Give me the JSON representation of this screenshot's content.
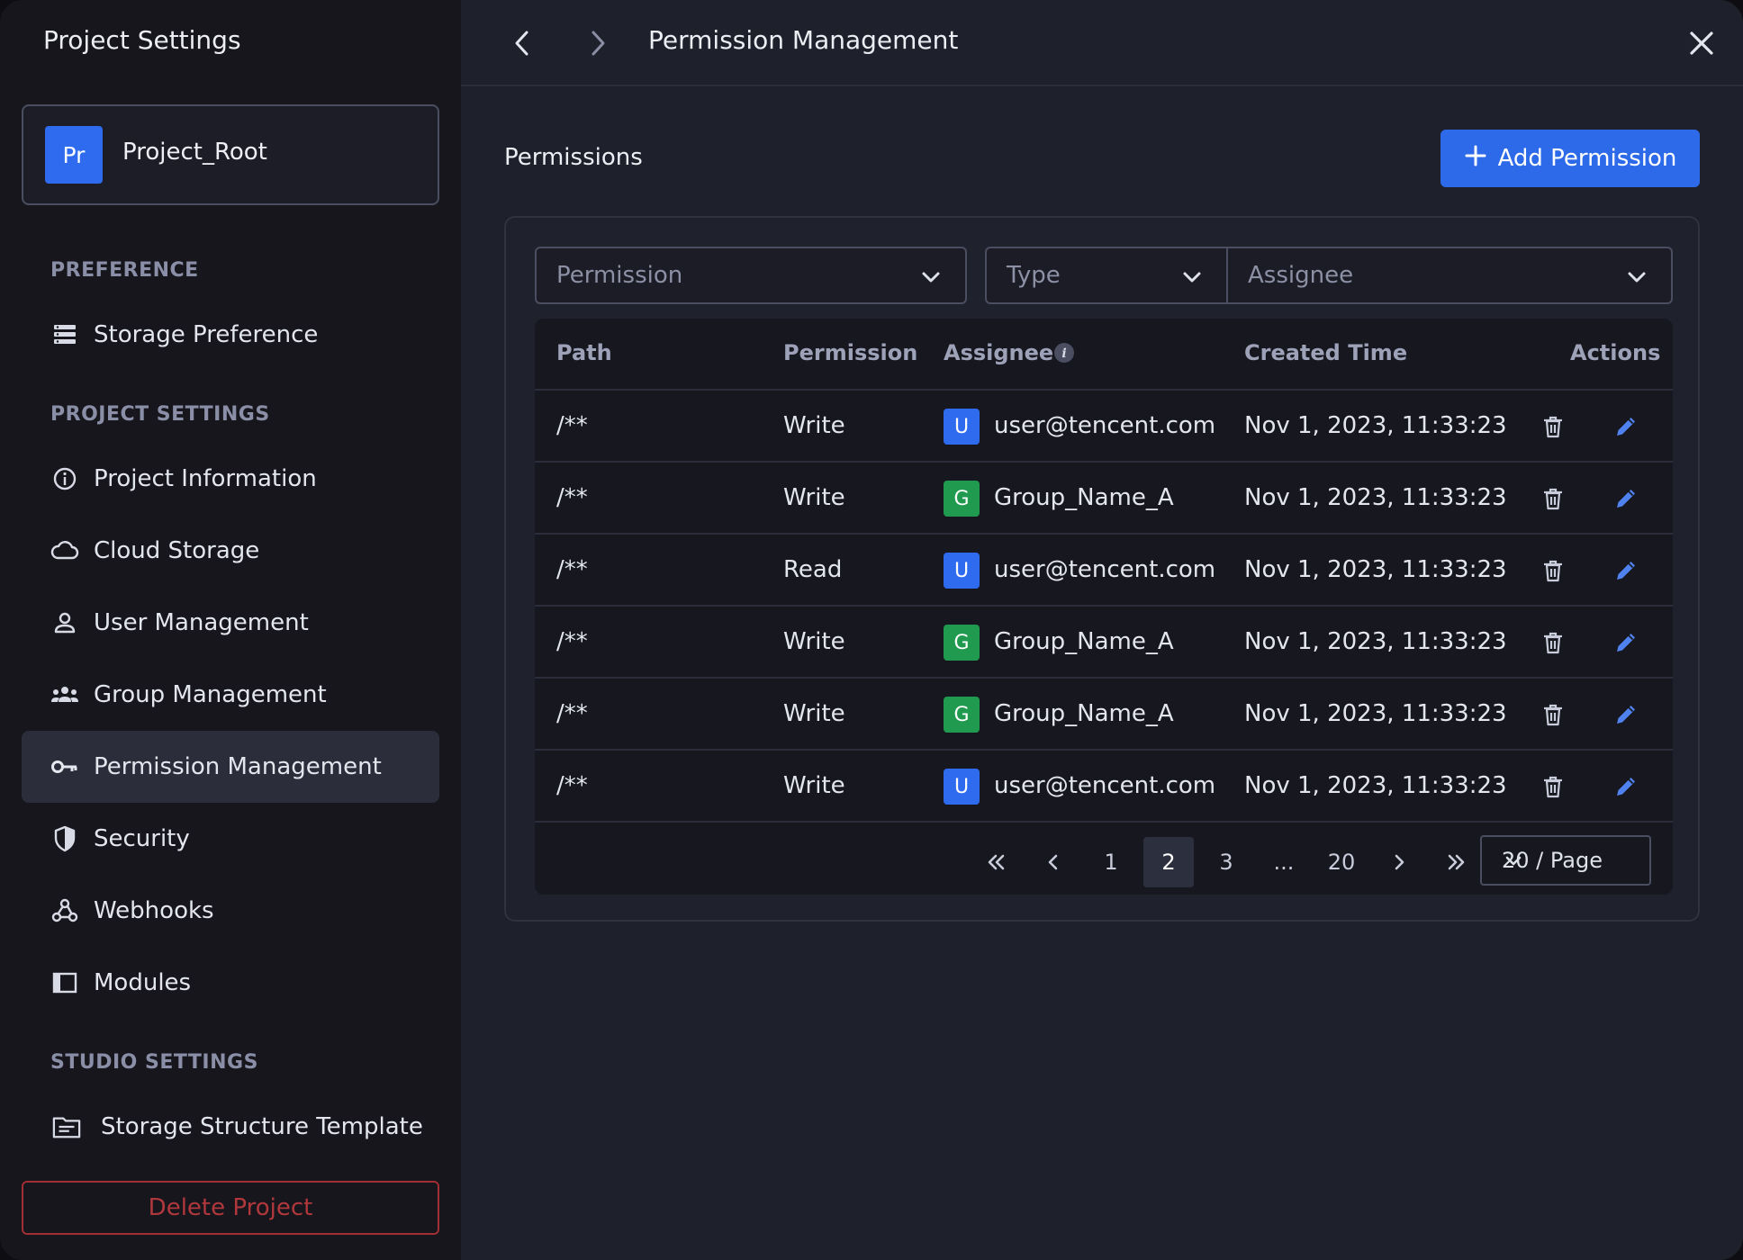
{
  "sidebar": {
    "title": "Project Settings",
    "project": {
      "avatar": "Pr",
      "name": "Project_Root"
    },
    "sections": [
      {
        "heading": "PREFERENCE"
      },
      {
        "heading": "PROJECT SETTINGS"
      },
      {
        "heading": "STUDIO SETTINGS"
      }
    ],
    "items": [
      {
        "label": "Storage Preference",
        "icon": "storage-list-icon"
      },
      {
        "label": "Project Information",
        "icon": "info-icon"
      },
      {
        "label": "Cloud Storage",
        "icon": "cloud-icon"
      },
      {
        "label": "User Management",
        "icon": "user-icon"
      },
      {
        "label": "Group Management",
        "icon": "group-icon"
      },
      {
        "label": "Permission Management",
        "icon": "key-icon",
        "active": true
      },
      {
        "label": "Security",
        "icon": "shield-icon"
      },
      {
        "label": "Webhooks",
        "icon": "webhook-icon"
      },
      {
        "label": "Modules",
        "icon": "module-icon"
      },
      {
        "label": "Storage Structure Template",
        "icon": "folder-template-icon"
      }
    ],
    "delete_label": "Delete Project"
  },
  "topbar": {
    "title": "Permission Management"
  },
  "main": {
    "title": "Permissions",
    "add_button": "Add Permission",
    "filters": {
      "permission_placeholder": "Permission",
      "type_placeholder": "Type",
      "assignee_placeholder": "Assignee"
    },
    "columns": [
      "Path",
      "Permission",
      "Assignee",
      "Created Time",
      "Actions"
    ],
    "rows": [
      {
        "path": "/**",
        "permission": "Write",
        "assignee_type": "U",
        "assignee": "user@tencent.com",
        "created": "Nov 1, 2023, 11:33:23"
      },
      {
        "path": "/**",
        "permission": "Write",
        "assignee_type": "G",
        "assignee": "Group_Name_A",
        "created": "Nov 1, 2023, 11:33:23"
      },
      {
        "path": "/**",
        "permission": "Read",
        "assignee_type": "U",
        "assignee": "user@tencent.com",
        "created": "Nov 1, 2023, 11:33:23"
      },
      {
        "path": "/**",
        "permission": "Write",
        "assignee_type": "G",
        "assignee": "Group_Name_A",
        "created": "Nov 1, 2023, 11:33:23"
      },
      {
        "path": "/**",
        "permission": "Write",
        "assignee_type": "G",
        "assignee": "Group_Name_A",
        "created": "Nov 1, 2023, 11:33:23"
      },
      {
        "path": "/**",
        "permission": "Write",
        "assignee_type": "U",
        "assignee": "user@tencent.com",
        "created": "Nov 1, 2023, 11:33:23"
      }
    ],
    "pagination": {
      "pages": [
        "1",
        "2",
        "3",
        "...",
        "20"
      ],
      "current": "2",
      "per_page": "20 / Page"
    }
  },
  "colors": {
    "accent": "#2d6ae9",
    "group_badge": "#1f9a4e",
    "danger": "#b0383c"
  }
}
